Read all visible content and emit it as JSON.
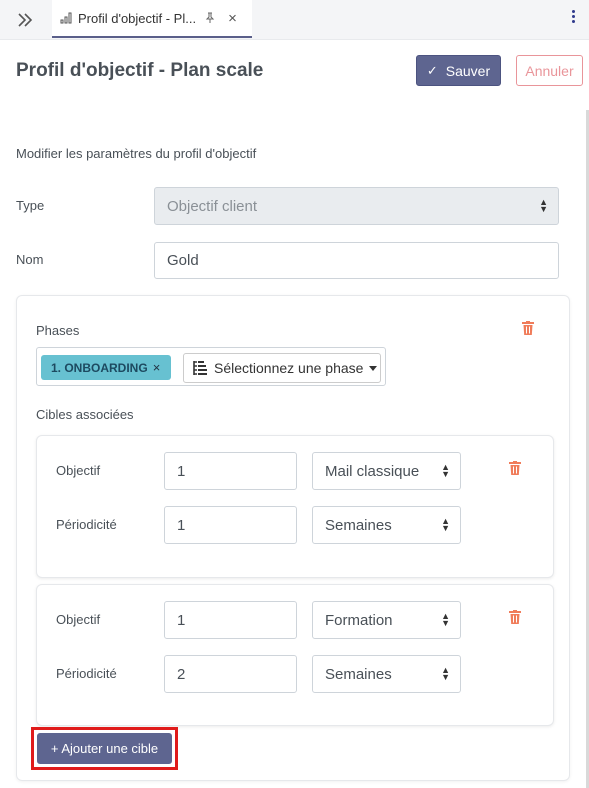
{
  "tabbar": {
    "tab_title": "Profil d'objectif - Pl...",
    "close_glyph": "×",
    "icons": [
      "double-chevron-right-icon",
      "bar-chart-icon",
      "pin-icon",
      "close-icon",
      "more-vertical-icon"
    ]
  },
  "header": {
    "title": "Profil d'objectif - Plan scale",
    "save_label": "Sauver",
    "cancel_label": "Annuler"
  },
  "form": {
    "subtitle": "Modifier les paramètres du profil d'objectif",
    "type_label": "Type",
    "type_value": "Objectif client",
    "name_label": "Nom",
    "name_value": "Gold"
  },
  "phases": {
    "label": "Phases",
    "selected_chip": "1. ONBOARDING",
    "chip_remove": "×",
    "dropdown_placeholder": "Sélectionnez une phase",
    "targets_label": "Cibles associées"
  },
  "targets": [
    {
      "objectif_label": "Objectif",
      "objectif_value": "1",
      "objectif_unit": "Mail classique",
      "periodicite_label": "Périodicité",
      "periodicite_value": "1",
      "periodicite_unit": "Semaines"
    },
    {
      "objectif_label": "Objectif",
      "objectif_value": "1",
      "objectif_unit": "Formation",
      "periodicite_label": "Périodicité",
      "periodicite_value": "2",
      "periodicite_unit": "Semaines"
    }
  ],
  "add_target_label": "+ Ajouter une cible",
  "colors": {
    "primary": "#5e6590",
    "danger": "#e9959a",
    "trash": "#f07c5a",
    "chip": "#67c1d1",
    "highlight": "#e01b1b"
  }
}
